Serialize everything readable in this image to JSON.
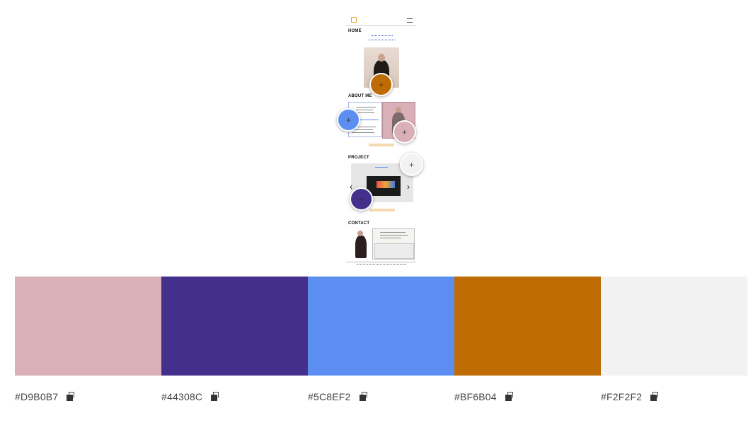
{
  "preview": {
    "nav": {
      "logo_icon": "logo-icon",
      "menu_icon": "hamburger-icon"
    },
    "sections": {
      "home": "HOME",
      "about": "ABOUT ME",
      "project": "PROJECT",
      "contact": "CONTACT"
    }
  },
  "pins": [
    {
      "name": "pin-orange",
      "color": "#BF6B04",
      "label": "+"
    },
    {
      "name": "pin-blue",
      "color": "#5C8EF2",
      "label": "+"
    },
    {
      "name": "pin-pink",
      "color": "#D9B0B7",
      "label": "+"
    },
    {
      "name": "pin-light-gray",
      "color": "#F2F2F2",
      "label": "+"
    },
    {
      "name": "pin-purple",
      "color": "#44308C",
      "label": "+"
    }
  ],
  "palette": [
    {
      "hex": "#D9B0B7",
      "copy_icon": "copy-icon"
    },
    {
      "hex": "#44308C",
      "copy_icon": "copy-icon"
    },
    {
      "hex": "#5C8EF2",
      "copy_icon": "copy-icon"
    },
    {
      "hex": "#BF6B04",
      "copy_icon": "copy-icon"
    },
    {
      "hex": "#F2F2F2",
      "copy_icon": "copy-icon"
    }
  ]
}
